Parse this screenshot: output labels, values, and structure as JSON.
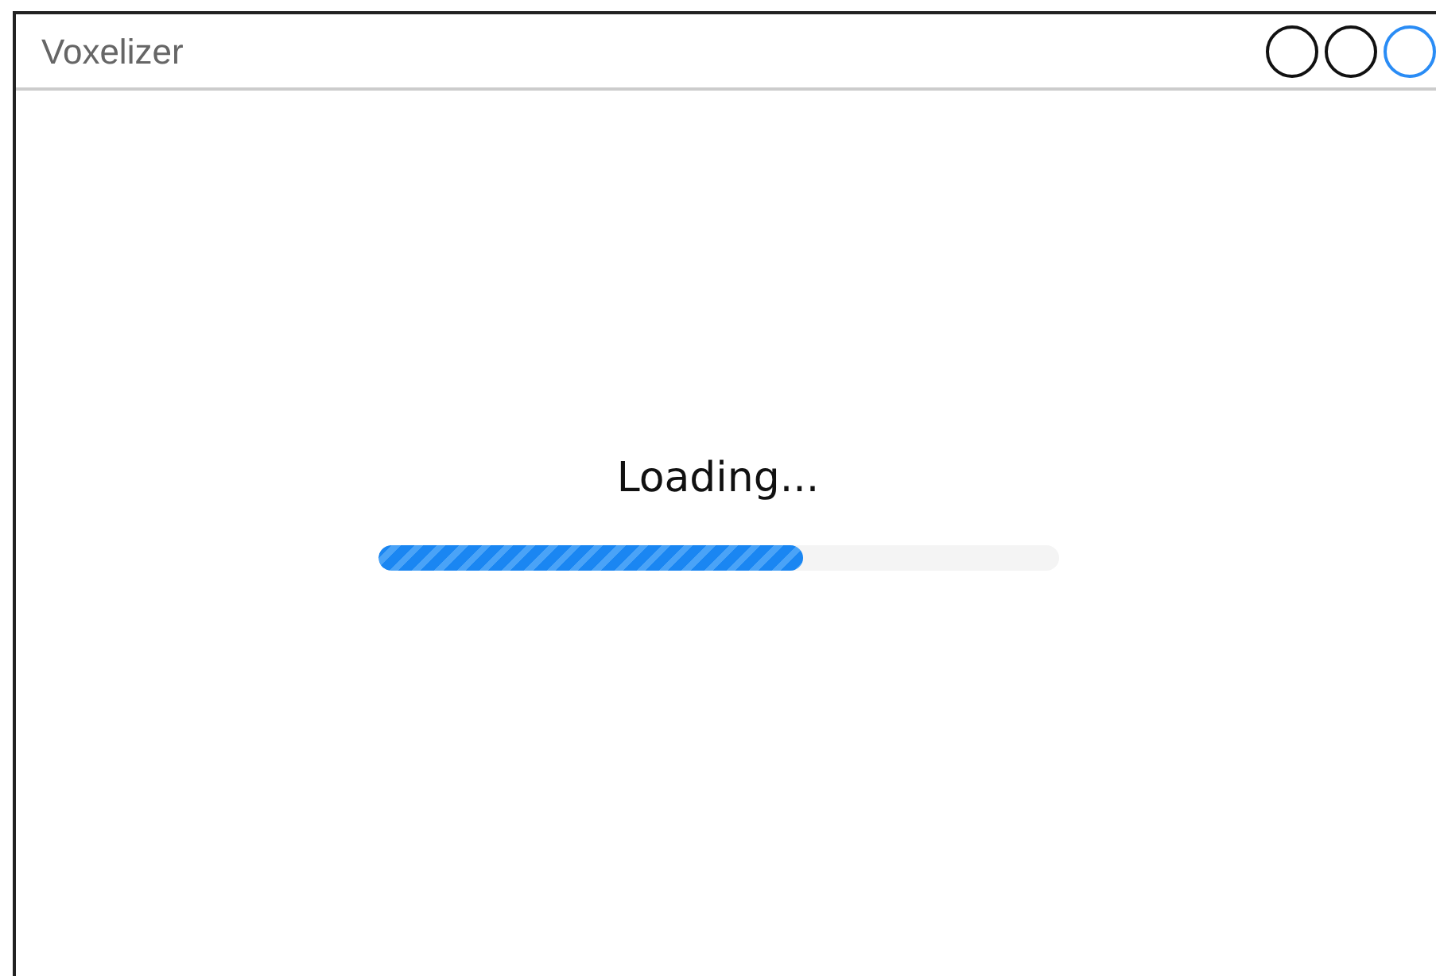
{
  "window": {
    "title": "Voxelizer",
    "controls": [
      {
        "highlighted": false
      },
      {
        "highlighted": false
      },
      {
        "highlighted": true
      }
    ]
  },
  "loading": {
    "message": "Loading...",
    "level": 0.626
  }
}
